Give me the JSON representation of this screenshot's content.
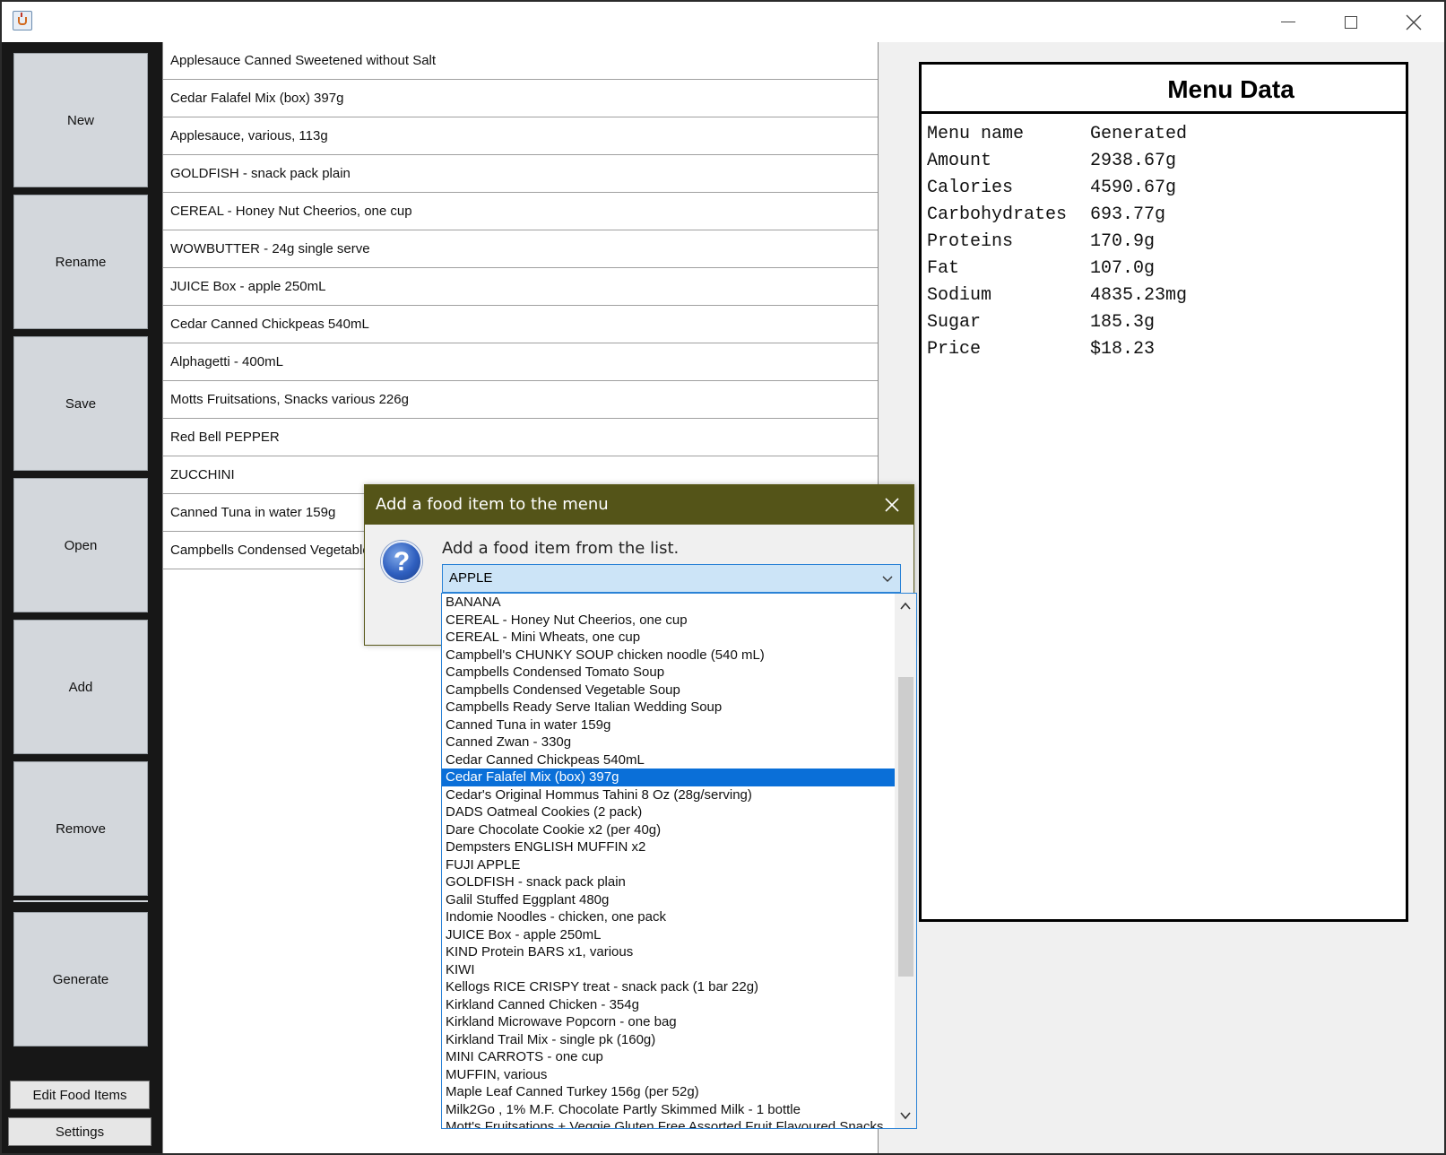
{
  "sidebar": {
    "buttons": [
      "New",
      "Rename",
      "Save",
      "Open",
      "Add",
      "Remove"
    ],
    "generate": "Generate",
    "edit_food_items": "Edit Food Items",
    "settings": "Settings"
  },
  "menu_items": [
    "Applesauce Canned Sweetened without Salt",
    "Cedar Falafel Mix (box) 397g",
    "Applesauce, various, 113g",
    "GOLDFISH - snack pack plain",
    "CEREAL - Honey Nut Cheerios, one cup",
    "WOWBUTTER - 24g single serve",
    "JUICE Box - apple 250mL",
    "Cedar Canned Chickpeas 540mL",
    "Alphagetti - 400mL",
    "Motts Fruitsations, Snacks various 226g",
    "Red Bell PEPPER",
    "ZUCCHINI",
    "Canned Tuna in water 159g",
    "Campbells Condensed Vegetable Soup"
  ],
  "menu_data": {
    "title": "Menu Data",
    "rows": [
      {
        "label": "Menu name",
        "value": "Generated"
      },
      {
        "label": "Amount",
        "value": "2938.67g"
      },
      {
        "label": "Calories",
        "value": "4590.67g"
      },
      {
        "label": "Carbohydrates",
        "value": "693.77g"
      },
      {
        "label": "Proteins",
        "value": "170.9g"
      },
      {
        "label": "Fat",
        "value": "107.0g"
      },
      {
        "label": "Sodium",
        "value": "4835.23mg"
      },
      {
        "label": "Sugar",
        "value": "185.3g"
      },
      {
        "label": "Price",
        "value": "$18.23"
      }
    ]
  },
  "dialog": {
    "title": "Add a food item to the menu",
    "message": "Add a food item from the list.",
    "selected_value": "APPLE",
    "icon": "question-icon"
  },
  "dropdown": {
    "selected_index": 10,
    "options": [
      "BANANA",
      "CEREAL - Honey Nut Cheerios, one cup",
      "CEREAL - Mini Wheats, one cup",
      "Campbell's CHUNKY SOUP chicken noodle (540 mL)",
      "Campbells Condensed Tomato Soup",
      "Campbells Condensed Vegetable Soup",
      "Campbells Ready Serve Italian Wedding Soup",
      "Canned Tuna in water 159g",
      "Canned Zwan - 330g",
      "Cedar Canned Chickpeas 540mL",
      "Cedar Falafel Mix (box) 397g",
      "Cedar's Original Hommus Tahini 8 Oz (28g/serving)",
      "DADS Oatmeal Cookies (2 pack)",
      "Dare Chocolate Cookie x2 (per 40g)",
      "Dempsters ENGLISH MUFFIN x2",
      "FUJI APPLE",
      "GOLDFISH - snack pack plain",
      "Galil Stuffed Eggplant 480g",
      "Indomie Noodles - chicken, one pack",
      "JUICE Box - apple 250mL",
      "KIND Protein BARS x1, various",
      "KIWI",
      "Kellogs RICE CRISPY treat - snack pack (1 bar 22g)",
      "Kirkland Canned Chicken - 354g",
      "Kirkland Microwave Popcorn - one bag",
      "Kirkland Trail Mix - single pk (160g)",
      "MINI CARROTS - one cup",
      "MUFFIN, various",
      "Maple Leaf Canned Turkey 156g (per 52g)",
      "Milk2Go , 1% M.F. Chocolate Partly Skimmed Milk - 1 bottle",
      "Mott's Fruitsations + Veggie Gluten Free Assorted Fruit Flavoured Snacks"
    ]
  }
}
